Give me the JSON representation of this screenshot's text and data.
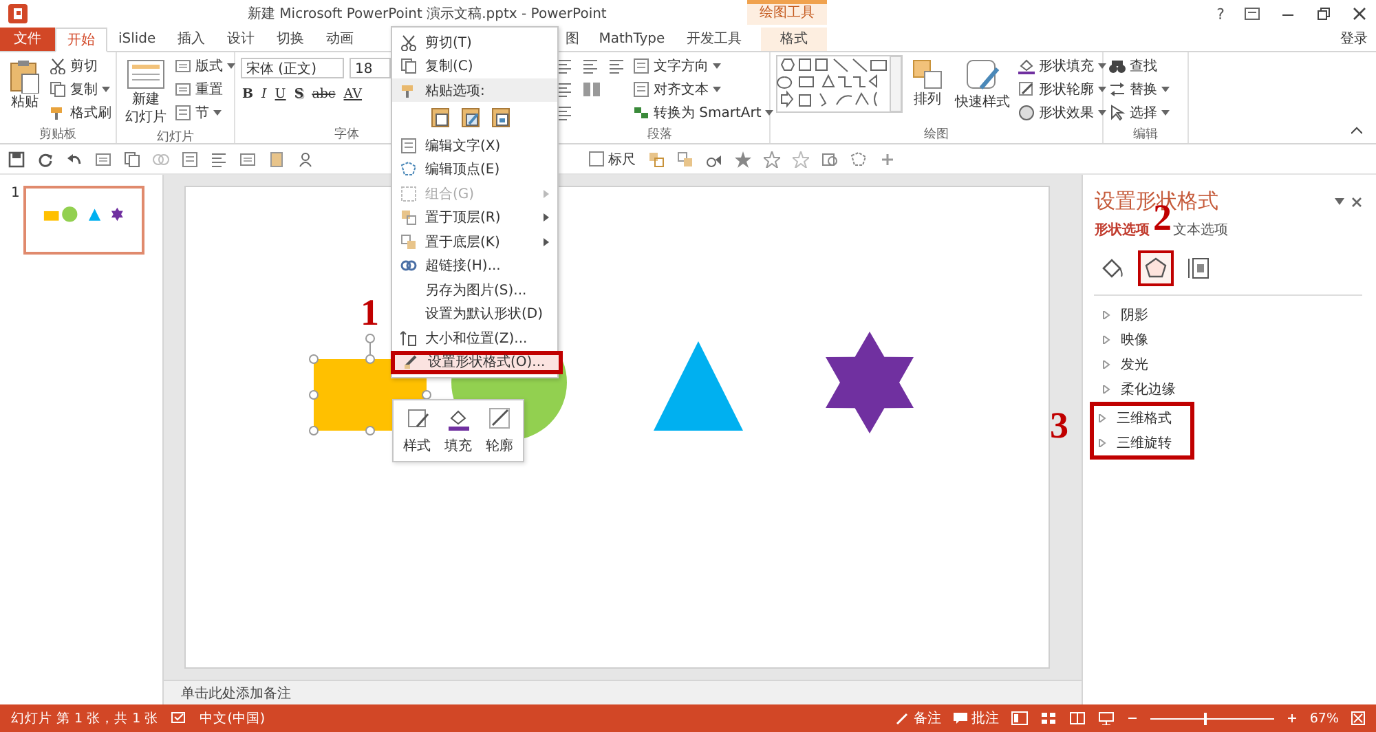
{
  "window": {
    "title": "新建 Microsoft PowerPoint 演示文稿.pptx - PowerPoint",
    "help": "?",
    "contextual_group": "绘图工具",
    "sign_in": "登录"
  },
  "ribbon_tabs": [
    {
      "label": "文件",
      "kind": "file",
      "selected": false
    },
    {
      "label": "开始",
      "kind": "tab",
      "selected": true
    },
    {
      "label": "iSlide",
      "kind": "tab",
      "selected": false
    },
    {
      "label": "插入",
      "kind": "tab",
      "selected": false
    },
    {
      "label": "设计",
      "kind": "tab",
      "selected": false
    },
    {
      "label": "切换",
      "kind": "tab",
      "selected": false
    },
    {
      "label": "动画",
      "kind": "tab",
      "selected": false
    },
    {
      "label": "图",
      "kind": "partial",
      "selected": false
    },
    {
      "label": "MathType",
      "kind": "tab",
      "selected": false
    },
    {
      "label": "开发工具",
      "kind": "tab",
      "selected": false
    },
    {
      "label": "格式",
      "kind": "contextual",
      "selected": false
    }
  ],
  "ribbon": {
    "clipboard": {
      "label": "剪贴板",
      "paste": "粘贴",
      "cut": "剪切",
      "copy": "复制",
      "format_painter": "格式刷"
    },
    "slides": {
      "label": "幻灯片",
      "new_slide": "新建",
      "new_slide_2": "幻灯片",
      "layout": "版式",
      "reset": "重置",
      "section": "节"
    },
    "font": {
      "label": "字体",
      "font_name": "宋体 (正文)",
      "font_size": "18",
      "buttons": [
        "B",
        "I",
        "U",
        "S",
        "abc",
        "AV"
      ]
    },
    "paragraph": {
      "label": "段落",
      "text_direction": "文字方向",
      "align_text": "对齐文本",
      "smartart": "转换为 SmartArt"
    },
    "drawing": {
      "label": "绘图",
      "arrange": "排列",
      "quick_styles": "快速样式",
      "shape_fill": "形状填充",
      "shape_outline": "形状轮廓",
      "shape_effects": "形状效果"
    },
    "editing": {
      "label": "编辑",
      "find": "查找",
      "replace": "替换",
      "select": "选择"
    }
  },
  "quick_access": {
    "ruler": {
      "label": "标尺",
      "checked": false
    }
  },
  "thumbnails": [
    {
      "number": "1",
      "selected": true
    }
  ],
  "slide": {
    "shapes": [
      {
        "kind": "rectangle",
        "color": "#ffc000",
        "selected": true
      },
      {
        "kind": "circle",
        "color": "#92d050",
        "selected": false
      },
      {
        "kind": "triangle",
        "color": "#00b0f0",
        "selected": false
      },
      {
        "kind": "star",
        "color": "#7030a0",
        "selected": false
      }
    ]
  },
  "notes": {
    "placeholder": "单击此处添加备注"
  },
  "context_menu": {
    "items": [
      {
        "kind": "item",
        "label": "剪切(T)",
        "disabled": false,
        "submenu": false,
        "framed": false
      },
      {
        "kind": "item",
        "label": "复制(C)",
        "disabled": false,
        "submenu": false,
        "framed": false
      },
      {
        "kind": "header",
        "label": "粘贴选项:"
      },
      {
        "kind": "paste_options"
      },
      {
        "kind": "item",
        "label": "编辑文字(X)",
        "disabled": false,
        "submenu": false,
        "framed": false
      },
      {
        "kind": "item",
        "label": "编辑顶点(E)",
        "disabled": false,
        "submenu": false,
        "framed": false
      },
      {
        "kind": "item",
        "label": "组合(G)",
        "disabled": true,
        "submenu": true,
        "framed": false
      },
      {
        "kind": "item",
        "label": "置于顶层(R)",
        "disabled": false,
        "submenu": true,
        "framed": false
      },
      {
        "kind": "item",
        "label": "置于底层(K)",
        "disabled": false,
        "submenu": true,
        "framed": false
      },
      {
        "kind": "item",
        "label": "超链接(H)...",
        "disabled": false,
        "submenu": false,
        "framed": false
      },
      {
        "kind": "item",
        "label": "另存为图片(S)...",
        "disabled": false,
        "submenu": false,
        "framed": false
      },
      {
        "kind": "item",
        "label": "设置为默认形状(D)",
        "disabled": false,
        "submenu": false,
        "framed": false
      },
      {
        "kind": "item",
        "label": "大小和位置(Z)...",
        "disabled": false,
        "submenu": false,
        "framed": false
      },
      {
        "kind": "item",
        "label": "设置形状格式(O)...",
        "disabled": false,
        "submenu": false,
        "framed": true
      }
    ]
  },
  "mini_toolbar": {
    "buttons": [
      "样式",
      "填充",
      "轮廓"
    ]
  },
  "format_pane": {
    "title": "设置形状格式",
    "tabs": [
      {
        "label": "形状选项",
        "selected": true
      },
      {
        "label": "文本选项",
        "selected": false
      }
    ],
    "icon_tabs": [
      {
        "selected": false,
        "framed": false
      },
      {
        "selected": true,
        "framed": true
      },
      {
        "selected": false,
        "framed": false
      }
    ],
    "sections": [
      {
        "label": "阴影",
        "expanded": false,
        "framed": false
      },
      {
        "label": "映像",
        "expanded": false,
        "framed": false
      },
      {
        "label": "发光",
        "expanded": false,
        "framed": false
      },
      {
        "label": "柔化边缘",
        "expanded": false,
        "framed": false
      },
      {
        "label": "三维格式",
        "expanded": false,
        "framed": true
      },
      {
        "label": "三维旋转",
        "expanded": false,
        "framed": true
      }
    ]
  },
  "annotations": [
    "1",
    "2",
    "3"
  ],
  "status_bar": {
    "slide_info": "幻灯片 第 1 张，共 1 张",
    "language": "中文(中国)",
    "notes": "备注",
    "comments": "批注",
    "zoom": {
      "level": 0.45,
      "reading": "67%"
    }
  }
}
